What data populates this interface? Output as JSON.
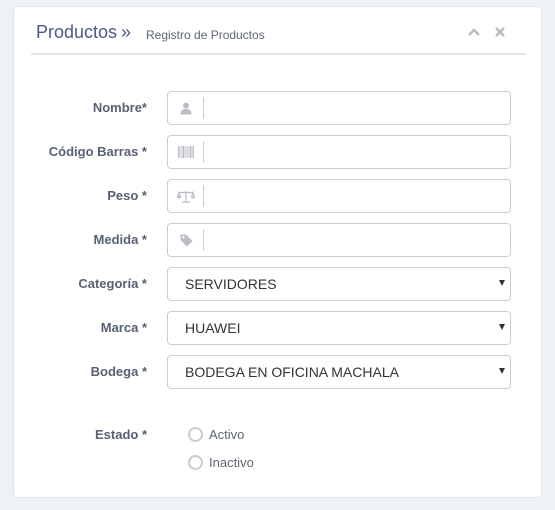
{
  "header": {
    "title": "Productos",
    "separator": "»",
    "subtitle": "Registro de Productos",
    "icons": [
      "chevron-up-icon",
      "close-icon"
    ]
  },
  "form": {
    "nombre": {
      "label": "Nombre*",
      "icon": "user-icon",
      "value": ""
    },
    "codigo": {
      "label": "Código Barras *",
      "icon": "barcode-icon",
      "value": ""
    },
    "peso": {
      "label": "Peso *",
      "icon": "balance-scale-icon",
      "value": ""
    },
    "medida": {
      "label": "Medida *",
      "icon": "tag-icon",
      "value": ""
    },
    "categoria": {
      "label": "Categoría *",
      "value": "SERVIDORES"
    },
    "marca": {
      "label": "Marca *",
      "value": "HUAWEI"
    },
    "bodega": {
      "label": "Bodega *",
      "value": "BODEGA EN OFICINA MACHALA"
    },
    "estado": {
      "label": "Estado *",
      "options": [
        "Activo",
        "Inactivo"
      ]
    }
  },
  "colors": {
    "title": "#4a5a88",
    "label": "#576075",
    "border": "#c9ced6",
    "icon": "#b9bec6"
  }
}
